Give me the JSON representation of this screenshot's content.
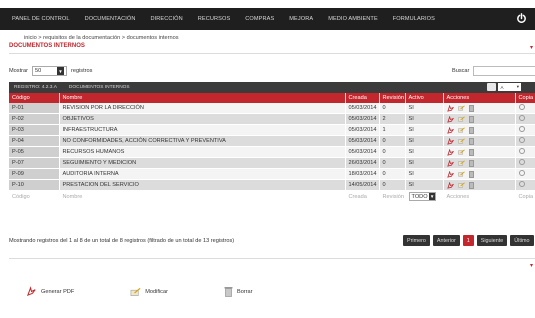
{
  "nav": {
    "items": [
      {
        "label": "PANEL DE CONTROL"
      },
      {
        "label": "DOCUMENTACIÓN"
      },
      {
        "label": "DIRECCIÓN"
      },
      {
        "label": "RECURSOS"
      },
      {
        "label": "COMPRAS"
      },
      {
        "label": "MEJORA"
      },
      {
        "label": "MEDIO AMBIENTE"
      },
      {
        "label": "FORMULARIOS"
      }
    ],
    "power_icon": "power-icon"
  },
  "breadcrumb": "inicio > requisitos de la documentación > documentos internos",
  "page_title": "DOCUMENTOS INTERNOS",
  "controls": {
    "show_label": "Mostrar",
    "page_size": "50",
    "records_label": "registros",
    "search_label": "Buscar",
    "search_value": ""
  },
  "caption": {
    "left": "REGISTRO: 4.2.3.A",
    "right": "DOCUMENTOS INTERNOS",
    "mini_select": "A"
  },
  "table": {
    "headers": [
      "Código",
      "Nombre",
      "Creada",
      "Revisión",
      "Activo",
      "Acciones",
      "Copia"
    ],
    "rows": [
      {
        "code": "P-01",
        "name": "REVISION POR LA DIRECCIÓN",
        "created": "05/03/2014",
        "rev": "0",
        "active": "SI"
      },
      {
        "code": "P-02",
        "name": "OBJETIVOS",
        "created": "05/03/2014",
        "rev": "2",
        "active": "SI"
      },
      {
        "code": "P-03",
        "name": "INFRAESTRUCTURA",
        "created": "05/03/2014",
        "rev": "1",
        "active": "SI"
      },
      {
        "code": "P-04",
        "name": "NO CONFORMIDADES, ACCIÓN CORRECTIVA Y PREVENTIVA",
        "created": "05/03/2014",
        "rev": "0",
        "active": "SI"
      },
      {
        "code": "P-05",
        "name": "RECURSOS HUMANOS",
        "created": "05/03/2014",
        "rev": "0",
        "active": "SI"
      },
      {
        "code": "P-07",
        "name": "SEGUIMIENTO Y MEDICION",
        "created": "26/03/2014",
        "rev": "0",
        "active": "SI"
      },
      {
        "code": "P-09",
        "name": "AUDITORIA INTERNA",
        "created": "18/03/2014",
        "rev": "0",
        "active": "SI"
      },
      {
        "code": "P-10",
        "name": "PRESTACION DEL SERVICIO",
        "created": "14/05/2014",
        "rev": "0",
        "active": "SI"
      }
    ],
    "footer": {
      "code": "Código",
      "name": "Nombre",
      "created": "Creada",
      "rev": "Revisión",
      "active": "TODO",
      "actions": "Acciones",
      "copy": "Copia"
    }
  },
  "info": "Mostrando registros del 1 al 8 de un total de 8 registros (filtrado de un total de 13 registros)",
  "pager": {
    "first": "Primero",
    "prev": "Anterior",
    "current": "1",
    "next": "Siguiente",
    "last": "Último"
  },
  "bottom": {
    "pdf": "Generar PDF",
    "edit": "Modificar",
    "delete": "Borrar"
  },
  "colors": {
    "accent": "#c1272d",
    "topbar": "#1f1f1f",
    "caption": "#3b3b3b"
  }
}
